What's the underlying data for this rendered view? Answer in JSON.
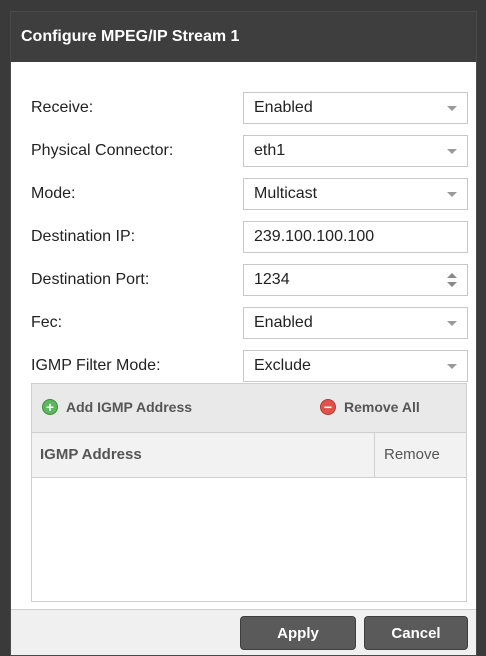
{
  "dialog": {
    "title": "Configure MPEG/IP Stream 1"
  },
  "fields": [
    {
      "label": "Receive:",
      "value": "Enabled",
      "kind": "select"
    },
    {
      "label": "Physical Connector:",
      "value": "eth1",
      "kind": "select"
    },
    {
      "label": "Mode:",
      "value": "Multicast",
      "kind": "select"
    },
    {
      "label": "Destination IP:",
      "value": "239.100.100.100",
      "kind": "text"
    },
    {
      "label": "Destination Port:",
      "value": "1234",
      "kind": "number"
    },
    {
      "label": "Fec:",
      "value": "Enabled",
      "kind": "select"
    },
    {
      "label": "IGMP Filter Mode:",
      "value": "Exclude",
      "kind": "select"
    }
  ],
  "igmp": {
    "add_label": "Add IGMP Address",
    "remove_all_label": "Remove All",
    "columns": [
      "IGMP Address",
      "Remove"
    ],
    "rows": []
  },
  "footer": {
    "apply_label": "Apply",
    "cancel_label": "Cancel"
  },
  "colors": {
    "titlebar": "#3e3e3e",
    "button": "#5a5a5a",
    "add_icon": "#5cb85c",
    "remove_icon": "#e0524a"
  }
}
